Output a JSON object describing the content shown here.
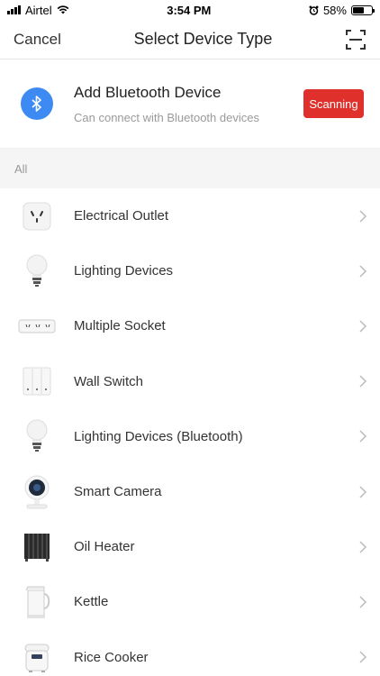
{
  "status_bar": {
    "carrier": "Airtel",
    "time": "3:54 PM",
    "battery": "58%",
    "battery_level": 0.58
  },
  "nav": {
    "cancel_label": "Cancel",
    "title": "Select Device Type",
    "scan_icon": "scan-icon"
  },
  "bluetooth": {
    "title": "Add Bluetooth Device",
    "subtitle": "Can connect with Bluetooth devices",
    "button_label": "Scanning",
    "accent_color": "#3d8bf2",
    "button_color": "#e0302b"
  },
  "section": {
    "label": "All"
  },
  "devices": [
    {
      "label": "Electrical Outlet",
      "icon": "outlet-icon"
    },
    {
      "label": "Lighting Devices",
      "icon": "bulb-icon"
    },
    {
      "label": "Multiple Socket",
      "icon": "power-strip-icon"
    },
    {
      "label": "Wall Switch",
      "icon": "wall-switch-icon"
    },
    {
      "label": "Lighting Devices (Bluetooth)",
      "icon": "bulb-icon"
    },
    {
      "label": "Smart Camera",
      "icon": "camera-icon"
    },
    {
      "label": "Oil Heater",
      "icon": "heater-icon"
    },
    {
      "label": "Kettle",
      "icon": "kettle-icon"
    },
    {
      "label": "Rice Cooker",
      "icon": "rice-cooker-icon"
    }
  ]
}
